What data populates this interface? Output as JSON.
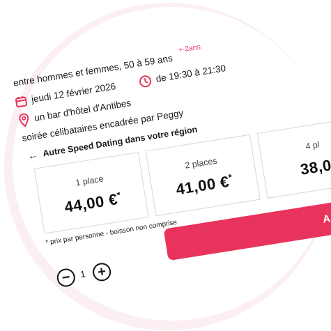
{
  "event": {
    "age_range": "entre hommes et femmes, 50 à 59 ans",
    "age_note": "+-2ans",
    "date": "jeudi 12 février 2026",
    "time": "de 19:30 à 21:30",
    "venue": "un bar d'hôtel d'Antibes",
    "host": "soirée célibataires encadrée par Peggy"
  },
  "other_link": {
    "arrow": "←",
    "label": "Autre Speed Dating dans votre région"
  },
  "prices": [
    {
      "label": "1 place",
      "amount": "44,00 €",
      "star": "*"
    },
    {
      "label": "2 places",
      "amount": "41,00 €",
      "star": "*"
    },
    {
      "label": "4 pl",
      "amount": "38,0"
    }
  ],
  "price_note": "* prix par personne - boisson non comprise",
  "quantity": {
    "minus": "−",
    "value": "1",
    "plus": "+"
  },
  "add_button": {
    "label": "AJOU"
  },
  "colors": {
    "accent": "#e8345c",
    "halo": "#fbeff1",
    "border": "#d7d7d7",
    "text": "#1a1a1a"
  }
}
